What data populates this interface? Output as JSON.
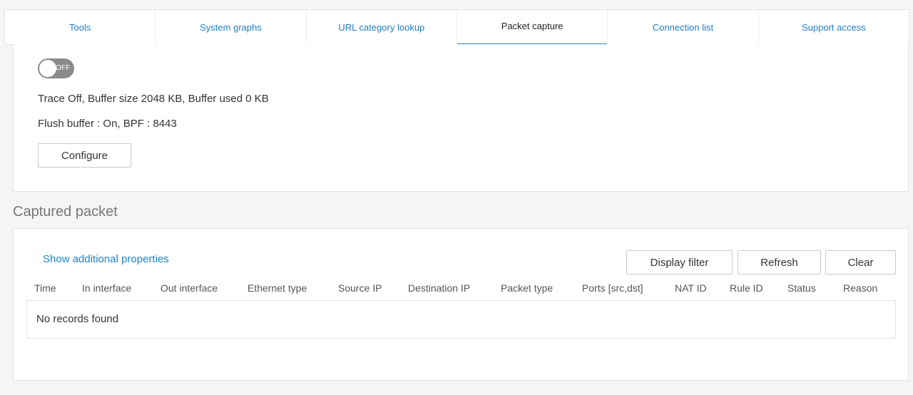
{
  "tabs": [
    {
      "label": "Tools"
    },
    {
      "label": "System graphs"
    },
    {
      "label": "URL category lookup"
    },
    {
      "label": "Packet capture"
    },
    {
      "label": "Connection list"
    },
    {
      "label": "Support access"
    }
  ],
  "active_tab": "Packet capture",
  "capture": {
    "toggle_text": "OFF",
    "status_line": "Trace Off, Buffer size 2048 KB, Buffer used 0 KB",
    "flush_line": "Flush buffer : On, BPF : 8443",
    "configure_label": "Configure"
  },
  "captured": {
    "title": "Captured packet",
    "show_props_label": "Show additional properties",
    "display_filter_label": "Display filter",
    "refresh_label": "Refresh",
    "clear_label": "Clear",
    "columns": [
      "Time",
      "In interface",
      "Out interface",
      "Ethernet type",
      "Source IP",
      "Destination IP",
      "Packet type",
      "Ports [src,dst]",
      "NAT ID",
      "Rule ID",
      "Status",
      "Reason"
    ],
    "empty_text": "No records found"
  },
  "colors": {
    "accent": "#1f7fc8",
    "toggle_off": "#8a8a8a"
  }
}
